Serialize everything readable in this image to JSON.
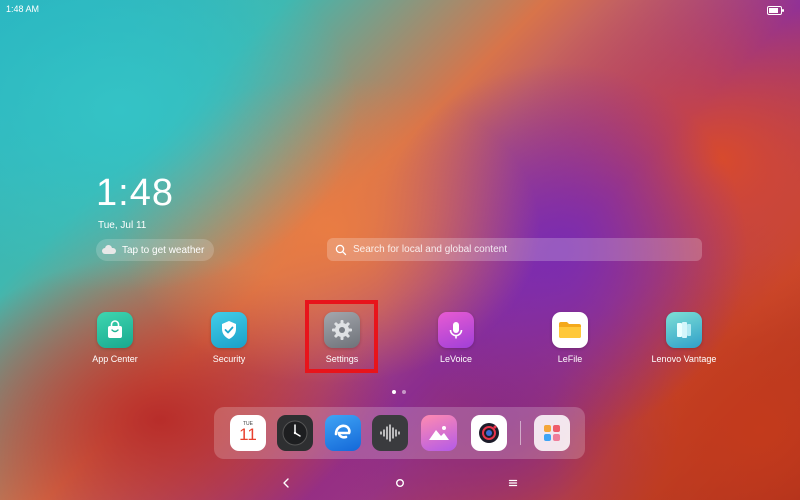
{
  "status_bar": {
    "time": "1:48 AM",
    "battery_level": 0.85
  },
  "lock_widget": {
    "clock": "1:48",
    "date": "Tue, Jul 11",
    "weather_prompt": "Tap to get weather"
  },
  "search": {
    "placeholder": "Search for local and global content"
  },
  "apps": [
    {
      "label": "App Center",
      "icon": "bag-icon"
    },
    {
      "label": "Security",
      "icon": "shield-check-icon"
    },
    {
      "label": "Settings",
      "icon": "gear-icon"
    },
    {
      "label": "LeVoice",
      "icon": "microphone-icon"
    },
    {
      "label": "LeFile",
      "icon": "folder-icon"
    },
    {
      "label": "Lenovo Vantage",
      "icon": "vantage-icon"
    }
  ],
  "highlighted_app": "Settings",
  "page_indicator": {
    "pages": 2,
    "current": 1
  },
  "dock": {
    "calendar_day": "TUE",
    "calendar_date": "11",
    "items": [
      "calendar-icon",
      "clock-icon",
      "browser-icon",
      "voice-recorder-icon",
      "gallery-icon",
      "camera-icon",
      "app-drawer-icon"
    ]
  },
  "colors": {
    "highlight": "#e8141b"
  }
}
